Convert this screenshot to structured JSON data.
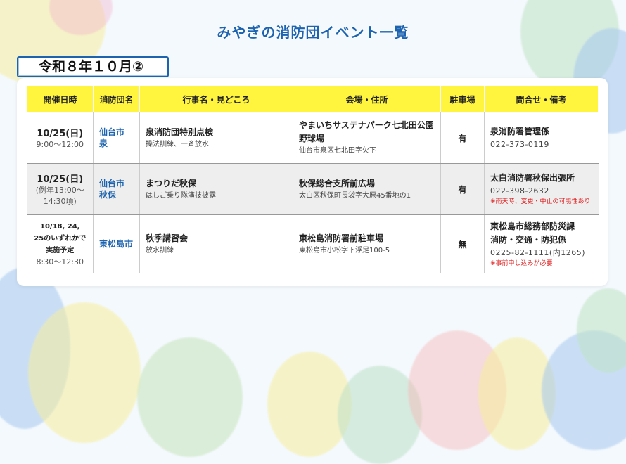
{
  "page": {
    "title": "みやぎの消防団イベント一覧",
    "period_label": "令和８年１０月②"
  },
  "table": {
    "headers": [
      "開催日時",
      "消防団名",
      "行事名・見どころ",
      "会場・住所",
      "駐車場",
      "問合せ・備考"
    ],
    "rows": [
      {
        "date_main": "10/25(日)",
        "date_sub": "9:00～12:00",
        "brigade": "仙台市\n泉",
        "event_name": "泉消防団特別点検",
        "event_desc": "操法訓練、一斉放水",
        "venue_name": "やまいちサステナパーク七北田公園\n野球場",
        "venue_addr": "仙台市泉区七北田字欠下",
        "parking": "有",
        "contact_name": "泉消防署管理係",
        "contact_tel": "022-373-0119",
        "contact_note": ""
      },
      {
        "date_main": "10/25(日)",
        "date_sub": "(例年13:00～\n14:30頃)",
        "brigade": "仙台市\n秋保",
        "event_name": "まつりだ秋保",
        "event_desc": "はしご乗り隊演技披露",
        "venue_name": "秋保総合支所前広場",
        "venue_addr": "太白区秋保町長袋字大原45番地の1",
        "parking": "有",
        "contact_name": "太白消防署秋保出張所",
        "contact_tel": "022-398-2632",
        "contact_note": "※雨天時、変更・中止の可能性あり"
      },
      {
        "date_main": "10/18, 24,\n25のいずれかで\n実施予定",
        "date_sub": "8:30～12:30",
        "brigade": "東松島市",
        "event_name": "秋季講習会",
        "event_desc": "放水訓練",
        "venue_name": "東松島消防署前駐車場",
        "venue_addr": "東松島市小松字下浮足100-5",
        "parking": "無",
        "contact_name": "東松島市総務部防災課\n消防・交通・防犯係",
        "contact_tel": "0225-82-1111(内1265)",
        "contact_note": "※事前申し込みが必要"
      }
    ]
  },
  "colors": {
    "accent_blue": "#1d64b0",
    "header_yellow": "#fff53e",
    "note_red": "#e02020"
  }
}
